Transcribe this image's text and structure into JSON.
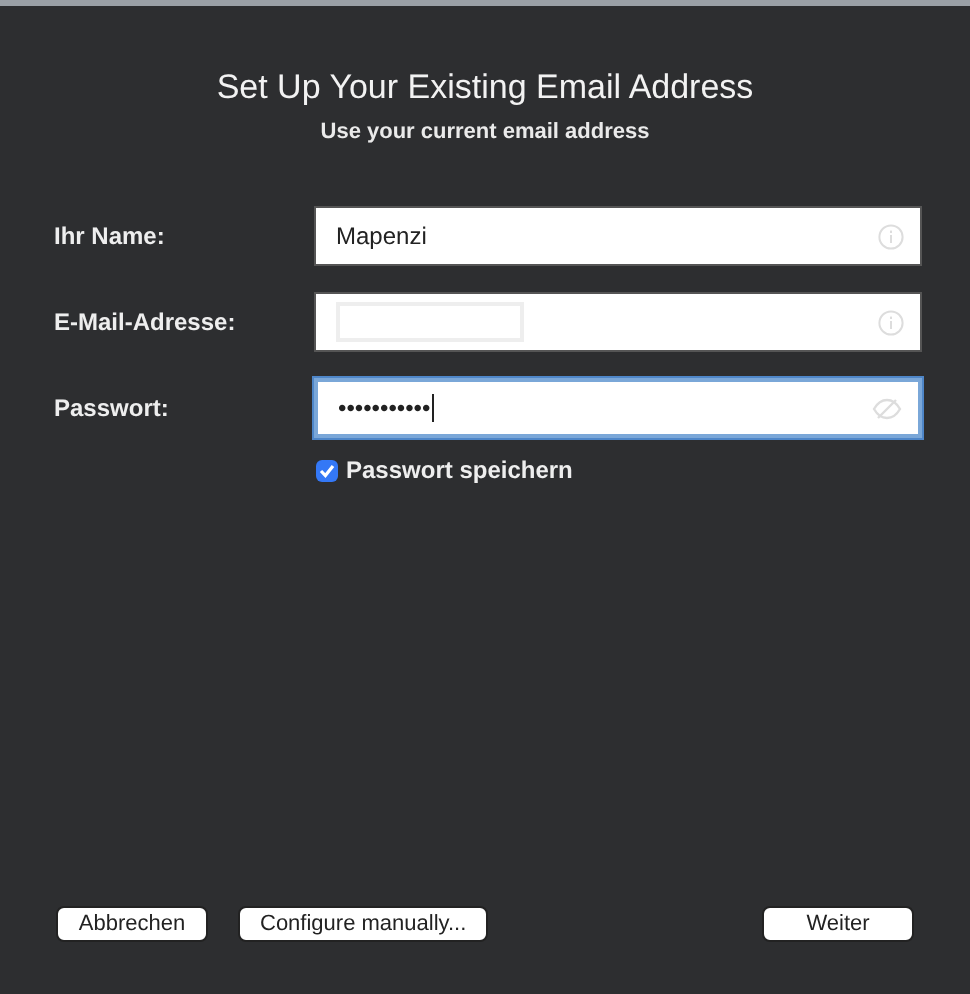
{
  "title": "Set Up Your Existing Email Address",
  "subtitle": "Use your current email address",
  "fields": [
    {
      "label": "Ihr Name:",
      "value": "Mapenzi",
      "kind": "text",
      "focused": false,
      "inner_box": false
    },
    {
      "label": "E-Mail-Adresse:",
      "kind": "text",
      "focused": false,
      "inner_box": true
    },
    {
      "label": "Passwort:",
      "value": "•••••••••••",
      "kind": "password",
      "focused": true,
      "inner_box": false
    }
  ],
  "remember": {
    "label": "Passwort speichern",
    "checked": true
  },
  "buttons": [
    {
      "label": "Abbrechen",
      "kind": "left"
    },
    {
      "label": "Configure manually...",
      "kind": "left"
    },
    {
      "label": "Weiter",
      "kind": "right"
    }
  ]
}
